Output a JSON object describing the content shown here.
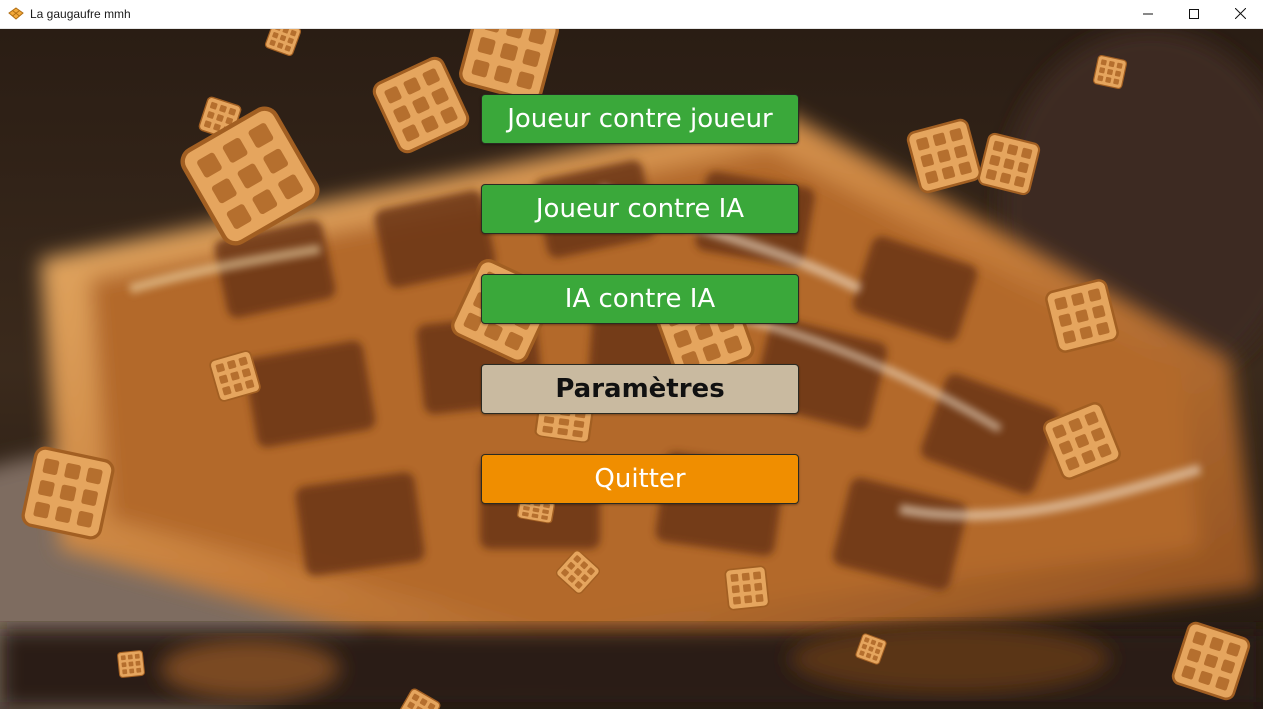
{
  "window": {
    "title": "La gaugaufre mmh",
    "app_icon": "waffle-icon",
    "controls": [
      "minimize-icon",
      "maximize-icon",
      "close-icon"
    ]
  },
  "menu": {
    "buttons": [
      {
        "label": "Joueur contre joueur",
        "color": "#3aa83a"
      },
      {
        "label": "Joueur contre IA",
        "color": "#3aa83a"
      },
      {
        "label": "IA contre IA",
        "color": "#3aa83a"
      },
      {
        "label": "Paramètres",
        "color": "#c9baa0"
      },
      {
        "label": "Quitter",
        "color": "#f08e00"
      }
    ]
  },
  "background": {
    "description_icon": "blurred-waffle-photo",
    "decoration_icon": "waffle-icon"
  }
}
